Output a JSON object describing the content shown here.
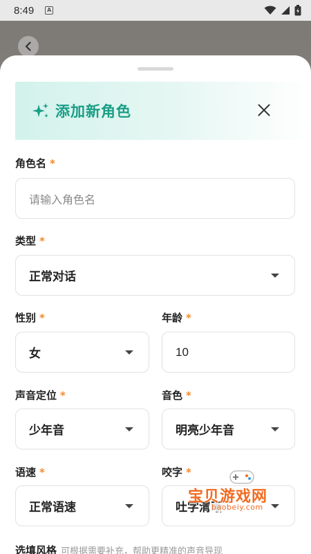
{
  "status_bar": {
    "time": "8:49",
    "app_icon_letter": "A"
  },
  "sheet": {
    "title": "添加新角色",
    "fields": {
      "name": {
        "label": "角色名",
        "required": "*",
        "placeholder": "请输入角色名"
      },
      "type": {
        "label": "类型",
        "required": "*",
        "value": "正常对话"
      },
      "gender": {
        "label": "性别",
        "required": "*",
        "value": "女"
      },
      "age": {
        "label": "年龄",
        "required": "*",
        "value": "10"
      },
      "voice_position": {
        "label": "声音定位",
        "required": "*",
        "value": "少年音"
      },
      "timbre": {
        "label": "音色",
        "required": "*",
        "value": "明亮少年音"
      },
      "speed": {
        "label": "语速",
        "required": "*",
        "value": "正常语速"
      },
      "articulation": {
        "label": "咬字",
        "required": "*",
        "value": "吐字清晰"
      }
    },
    "style": {
      "label": "选填风格",
      "hint": "可根据需要补充，帮助更精准的声音导现"
    }
  },
  "watermark": {
    "text": "宝贝游戏网",
    "url": "baobeiy.com"
  },
  "colors": {
    "accent": "#1a9e86",
    "required": "#f08a2e",
    "header_bg": "#d3f2ec"
  }
}
